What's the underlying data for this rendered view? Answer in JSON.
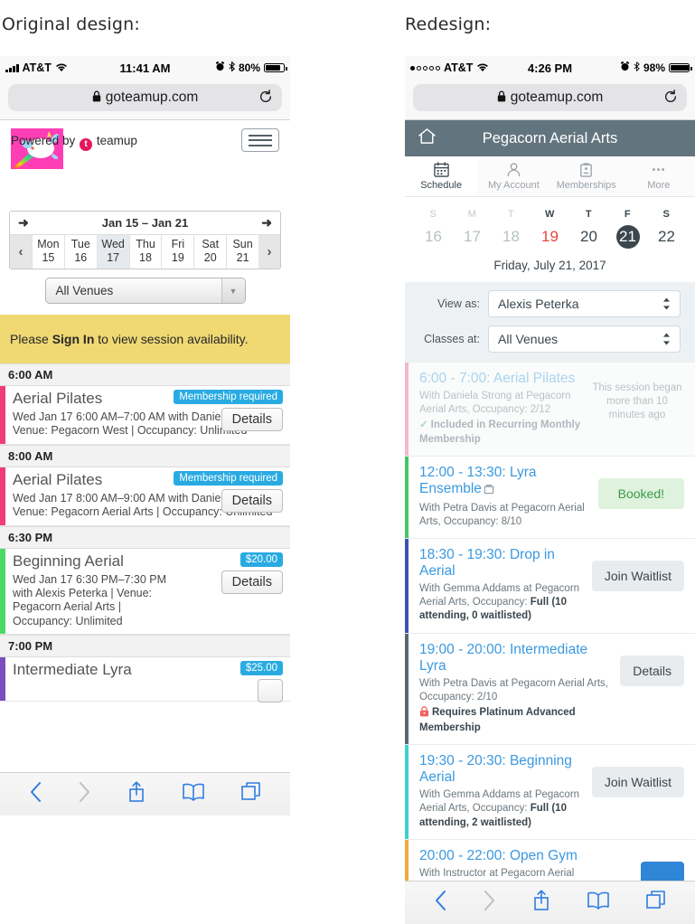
{
  "captions": {
    "left": "Original design:",
    "right": "Redesign:"
  },
  "left_phone": {
    "status_bar": {
      "carrier": "AT&T",
      "time": "11:41 AM",
      "battery_percent": "80%",
      "wifi_icon": "wifi-icon",
      "alarm_icon": "alarm-icon",
      "bluetooth_icon": "bluetooth-icon",
      "battery_icon": "battery-icon",
      "signal_icon": "signal-bars-icon"
    },
    "browser": {
      "url": "goteamup.com",
      "lock_icon": "lock-icon",
      "reload_icon": "reload-icon"
    },
    "brand": {
      "powered_by_prefix": "Powered by",
      "powered_by_name": "teamup",
      "logo_icon": "unicorn-logo",
      "menu_icon": "hamburger-menu-icon"
    },
    "week_picker": {
      "range": "Jan 15 – Jan 21",
      "prev_week_icon": "arrow-left-icon",
      "next_week_icon": "arrow-right-icon",
      "prev_day_icon": "chevron-left-icon",
      "next_day_icon": "chevron-right-icon",
      "days": [
        {
          "dow": "Mon",
          "num": "15",
          "selected": false
        },
        {
          "dow": "Tue",
          "num": "16",
          "selected": false
        },
        {
          "dow": "Wed",
          "num": "17",
          "selected": true
        },
        {
          "dow": "Thu",
          "num": "18",
          "selected": false
        },
        {
          "dow": "Fri",
          "num": "19",
          "selected": false
        },
        {
          "dow": "Sat",
          "num": "20",
          "selected": false
        },
        {
          "dow": "Sun",
          "num": "21",
          "selected": false
        }
      ]
    },
    "venue_select": {
      "value": "All Venues",
      "caret_icon": "caret-down-icon"
    },
    "signin_banner": {
      "before": "Please ",
      "link": "Sign In",
      "after": " to view session availability."
    },
    "schedule": [
      {
        "kind": "time",
        "label": "6:00 AM"
      },
      {
        "kind": "session",
        "bar_color": "#ee3d77",
        "title": "Aerial Pilates",
        "pill": "Membership required",
        "pill_color": "#29abe2",
        "meta": "Wed Jan 17 6:00 AM–7:00 AM with Daniela Strong | Venue: Pegacorn West | Occupancy: Unlimited",
        "action": "Details"
      },
      {
        "kind": "time",
        "label": "8:00 AM"
      },
      {
        "kind": "session",
        "bar_color": "#ee3d77",
        "title": "Aerial Pilates",
        "pill": "Membership required",
        "pill_color": "#29abe2",
        "meta": "Wed Jan 17 8:00 AM–9:00 AM with Daniela Strong | Venue: Pegacorn Aerial Arts | Occupancy: Unlimited",
        "action": "Details"
      },
      {
        "kind": "time",
        "label": "6:30 PM"
      },
      {
        "kind": "session",
        "bar_color": "#4cd964",
        "title": "Beginning Aerial",
        "pill": "$20.00",
        "pill_color": "#29abe2",
        "meta": "Wed Jan 17 6:30 PM–7:30 PM with Alexis Peterka | Venue: Pegacorn Aerial Arts | Occupancy: Unlimited",
        "action": "Details"
      },
      {
        "kind": "time",
        "label": "7:00 PM"
      },
      {
        "kind": "session",
        "bar_color": "#7a4fbd",
        "title": "Intermediate Lyra",
        "pill": "$25.00",
        "pill_color": "#29abe2",
        "meta": "",
        "action": ""
      }
    ],
    "toolbar": {
      "back_icon": "chevron-back-icon",
      "forward_icon": "chevron-forward-icon",
      "share_icon": "share-icon",
      "bookmarks_icon": "book-icon",
      "tabs_icon": "tabs-icon"
    }
  },
  "right_phone": {
    "status_bar": {
      "carrier": "AT&T",
      "time": "4:26 PM",
      "battery_percent": "98%",
      "wifi_icon": "wifi-icon",
      "alarm_icon": "alarm-icon",
      "bluetooth_icon": "bluetooth-icon",
      "battery_icon": "battery-icon",
      "signal_icon": "signal-dots-icon"
    },
    "browser": {
      "url": "goteamup.com",
      "lock_icon": "lock-icon",
      "reload_icon": "reload-icon"
    },
    "appbar": {
      "title": "Pegacorn Aerial Arts",
      "home_icon": "home-icon",
      "color": "#62747e"
    },
    "tabs": [
      {
        "label": "Schedule",
        "icon": "calendar-icon",
        "active": true
      },
      {
        "label": "My Account",
        "icon": "person-icon",
        "active": false
      },
      {
        "label": "Memberships",
        "icon": "card-icon",
        "active": false
      },
      {
        "label": "More",
        "icon": "ellipsis-icon",
        "active": false
      }
    ],
    "dates": [
      {
        "dow": "S",
        "num": "16",
        "state": "far"
      },
      {
        "dow": "M",
        "num": "17",
        "state": "far"
      },
      {
        "dow": "T",
        "num": "18",
        "state": "far"
      },
      {
        "dow": "W",
        "num": "19",
        "state": "today"
      },
      {
        "dow": "T",
        "num": "20",
        "state": "dark"
      },
      {
        "dow": "F",
        "num": "21",
        "state": "selected"
      },
      {
        "dow": "S",
        "num": "22",
        "state": "dark"
      }
    ],
    "full_date": "Friday, July 21, 2017",
    "filters": [
      {
        "label": "View as:",
        "value": "Alexis Peterka",
        "caret_icon": "up-down-caret-icon"
      },
      {
        "label": "Classes at:",
        "value": "All Venues",
        "caret_icon": "up-down-caret-icon"
      }
    ],
    "sessions": [
      {
        "bar_color": "#f4b9c6",
        "title": "6:00 - 7:00: Aerial Pilates",
        "meta": "With Daniela Strong at Pegacorn Aerial Arts, Occupancy: 2/12",
        "note": "Included in Recurring Monthly Membership",
        "note_icon": "check-icon",
        "side_note": "This session began more than 10 minutes ago",
        "past": true,
        "action": "",
        "action_style": ""
      },
      {
        "bar_color": "#44c767",
        "title": "12:00 - 13:30: Lyra Ensemble",
        "title_icon": "bag-icon",
        "meta": "With Petra Davis at Pegacorn Aerial Arts, Occupancy: 8/10",
        "note": "",
        "action": "Booked!",
        "action_style": "booked",
        "past": false
      },
      {
        "bar_color": "#3f51b5",
        "title": "18:30 - 19:30: Drop in Aerial",
        "meta_prefix": "With Gemma Addams at Pegacorn Aerial Arts, Occupancy: ",
        "meta_bold": "Full (10 attending, 0 waitlisted)",
        "note": "",
        "action": "Join Waitlist",
        "action_style": "grey",
        "past": false
      },
      {
        "bar_color": "#5a6770",
        "title": "19:00 - 20:00: Intermediate Lyra",
        "meta": "With Petra Davis at Pegacorn Aerial Arts, Occupancy: 2/10",
        "note": "Requires Platinum Advanced Membership",
        "note_icon": "lock-icon",
        "action": "Details",
        "action_style": "grey",
        "past": false
      },
      {
        "bar_color": "#3ecfd0",
        "title": "19:30 - 20:30: Beginning Aerial",
        "meta_prefix": "With Gemma Addams at Pegacorn Aerial Arts, Occupancy: ",
        "meta_bold": "Full (10 attending, 2 waitlisted)",
        "note": "",
        "action": "Join Waitlist",
        "action_style": "grey",
        "past": false
      },
      {
        "bar_color": "#f0ab3e",
        "title": "20:00 - 22:00: Open Gym",
        "meta": "With Instructor at Pegacorn Aerial",
        "note": "",
        "action": "",
        "action_style": "blue",
        "past": false
      }
    ],
    "toolbar": {
      "back_icon": "chevron-back-icon",
      "forward_icon": "chevron-forward-icon",
      "share_icon": "share-icon",
      "bookmarks_icon": "book-icon",
      "tabs_icon": "tabs-icon"
    }
  }
}
